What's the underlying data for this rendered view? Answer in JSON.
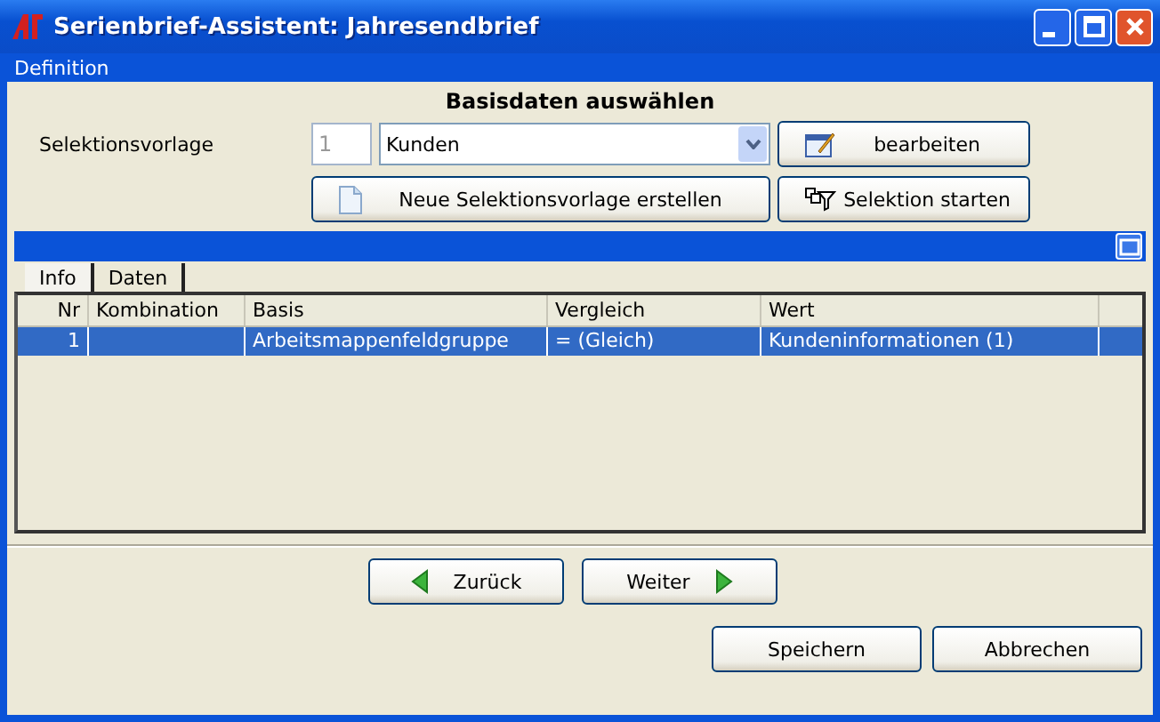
{
  "window": {
    "title": "Serienbrief-Assistent: Jahresendbrief"
  },
  "menu": [
    "Definition"
  ],
  "heading": "Basisdaten auswählen",
  "selection": {
    "label": "Selektionsvorlage",
    "number": "1",
    "value": "Kunden"
  },
  "buttons_top": [
    {
      "label": "bearbeiten",
      "kind": "edit"
    },
    {
      "label": "Neue Selektionsvorlage erstellen",
      "kind": "new"
    },
    {
      "label": "Selektion starten",
      "kind": "filter"
    }
  ],
  "tabs": [
    {
      "label": "Info",
      "selected": true
    },
    {
      "label": "Daten",
      "selected": false
    }
  ],
  "table": {
    "columns": [
      "Nr",
      "Kombination",
      "Basis",
      "Vergleich",
      "Wert"
    ],
    "rows": [
      {
        "cells": [
          "1",
          "",
          "Arbeitsmappenfeldgruppe",
          "=  (Gleich)",
          "Kundeninformationen (1)"
        ],
        "selected": true
      }
    ]
  },
  "nav_buttons": [
    {
      "label": "Zurück",
      "kind": "back"
    },
    {
      "label": "Weiter",
      "kind": "next"
    }
  ],
  "bottom_buttons": [
    "Speichern",
    "Abbrechen"
  ]
}
